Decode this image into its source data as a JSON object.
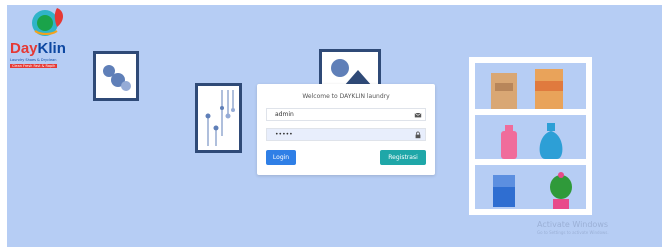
{
  "brand": {
    "name_day": "Day",
    "name_klin": "Klin",
    "tagline": "Laundry Shoes & Dryclean",
    "slogan": "Clean Fresh Fast & Rapih"
  },
  "login": {
    "title": "Welcome to DAYKLIN laundry",
    "username_value": "admin",
    "password_value": "•••••",
    "login_label": "Login",
    "register_label": "Registrasi"
  },
  "watermark": {
    "title": "Activate Windows",
    "subtitle": "Go to Settings to activate Windows."
  },
  "colors": {
    "background": "#b6cdf4",
    "frame": "#2f4a77",
    "login_button": "#2f7fe6",
    "register_button": "#1fa7a8",
    "logo_red": "#e53935",
    "logo_blue": "#0d47a1"
  },
  "icons": [
    "envelope-icon",
    "lock-icon"
  ]
}
